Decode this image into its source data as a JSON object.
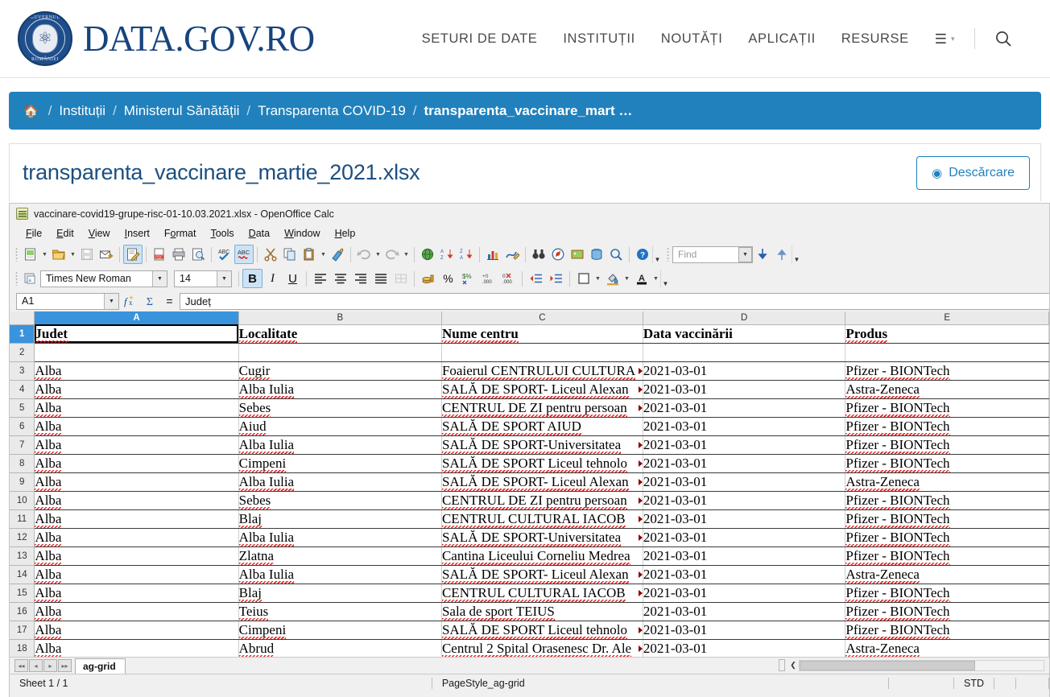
{
  "site": {
    "brand_name": "DATA.GOV.RO",
    "seal_top_text": "GUVERNUL",
    "seal_bottom_text": "ROMÂNIEI",
    "nav": [
      {
        "label": "SETURI DE DATE",
        "name": "nav-seturi-de-date"
      },
      {
        "label": "INSTITUȚII",
        "name": "nav-institutii"
      },
      {
        "label": "NOUTĂȚI",
        "name": "nav-noutati"
      },
      {
        "label": "APLICAȚII",
        "name": "nav-aplicatii"
      },
      {
        "label": "RESURSE",
        "name": "nav-resurse"
      }
    ],
    "menu_icon": "hamburger-icon",
    "menu_caret": "▾",
    "search_icon": "search-icon",
    "accent_color": "#2081bd",
    "brand_color": "#16447e"
  },
  "breadcrumb": {
    "home_icon": "home-icon",
    "separator": "/",
    "items": [
      "Instituții",
      "Ministerul Sănătății",
      "Transparenta COVID-19"
    ],
    "current": "transparenta_vaccinare_mart …"
  },
  "resource": {
    "title": "transparenta_vaccinare_martie_2021.xlsx",
    "download_label": "Descărcare",
    "download_icon": "download-circle-icon"
  },
  "office": {
    "window_title": "vaccinare-covid19-grupe-risc-01-10.03.2021.xlsx - OpenOffice Calc",
    "app_icon": "calc-document-icon",
    "menus": [
      "File",
      "Edit",
      "View",
      "Insert",
      "Format",
      "Tools",
      "Data",
      "Window",
      "Help"
    ],
    "toolbar_icons": [
      "new-document-icon",
      "open-folder-icon",
      "save-icon",
      "email-document-icon",
      "edit-file-icon",
      "export-pdf-icon",
      "print-icon",
      "print-preview-icon",
      "spelling-check-icon",
      "autospellcheck-icon",
      "cut-scissors-icon",
      "copy-icon",
      "paste-icon",
      "clone-formatting-brush-icon",
      "undo-icon",
      "redo-icon",
      "hyperlink-globe-icon",
      "sort-ascending-icon",
      "sort-descending-icon",
      "insert-chart-icon",
      "draw-functions-icon",
      "find-replace-binoculars-icon",
      "navigator-compass-icon",
      "gallery-image-icon",
      "data-sources-icon",
      "zoom-magnifier-icon",
      "help-icon"
    ],
    "find": {
      "placeholder": "Find",
      "find_next_icon": "find-next-arrow-icon",
      "find_previous_icon": "find-previous-arrow-icon"
    },
    "format": {
      "style_icon": "apply-style-icon",
      "font_name": "Times New Roman",
      "font_size": "14",
      "bold_label": "B",
      "italic_label": "I",
      "underline_label": "U",
      "bold_active": true,
      "align_icons": [
        "align-left-icon",
        "align-center-icon",
        "align-right-icon",
        "align-justified-icon",
        "merge-cells-icon"
      ],
      "number_icons": [
        "currency-format-icon",
        "percent-format-icon",
        "number-format-icon",
        "add-decimal-icon",
        "delete-decimal-icon",
        "decrease-indent-icon",
        "increase-indent-icon",
        "borders-icon",
        "background-color-icon",
        "font-color-icon"
      ]
    },
    "formula_bar": {
      "name_box": "A1",
      "function_wizard_icon": "fx-icon",
      "sum_icon": "sigma-icon",
      "equals_icon": "=",
      "content": "Județ"
    },
    "sheet_tabs": {
      "first_icon": "first-sheet-icon",
      "prev_icon": "previous-sheet-icon",
      "next_icon": "next-sheet-icon",
      "last_icon": "last-sheet-icon",
      "active_tab": "ag-grid"
    },
    "status": {
      "sheet_count": "Sheet 1 / 1",
      "page_style": "PageStyle_ag-grid",
      "selection_mode": "STD"
    }
  },
  "spreadsheet": {
    "columns": [
      "A",
      "B",
      "C",
      "D",
      "E"
    ],
    "selected_column": "A",
    "selected_row": 1,
    "selected_cell": "A1",
    "rows": [
      {
        "n": 1,
        "cells": [
          "Judet",
          "Localitate",
          "Nume centru",
          "Data vaccinării",
          "Produs"
        ],
        "header": true
      },
      {
        "n": 2,
        "cells": [
          "",
          "",
          "",
          "",
          ""
        ]
      },
      {
        "n": 3,
        "cells": [
          "Alba",
          "Cugir",
          "Foaierul CENTRULUI CULTURA",
          "2021-03-01",
          "Pfizer - BIONTech"
        ],
        "overflow_c": true
      },
      {
        "n": 4,
        "cells": [
          "Alba",
          "Alba Iulia",
          "SALĂ DE SPORT- Liceul Alexan",
          "2021-03-01",
          "Astra-Zeneca"
        ],
        "overflow_c": true
      },
      {
        "n": 5,
        "cells": [
          "Alba",
          "Sebes",
          "CENTRUL DE ZI pentru persoan",
          "2021-03-01",
          "Pfizer - BIONTech"
        ],
        "overflow_c": true
      },
      {
        "n": 6,
        "cells": [
          "Alba",
          "Aiud",
          "SALĂ DE SPORT AIUD",
          "2021-03-01",
          "Pfizer - BIONTech"
        ],
        "overflow_c": false
      },
      {
        "n": 7,
        "cells": [
          "Alba",
          "Alba Iulia",
          "SALĂ DE SPORT-Universitatea",
          "2021-03-01",
          "Pfizer - BIONTech"
        ],
        "overflow_c": true
      },
      {
        "n": 8,
        "cells": [
          "Alba",
          "Cimpeni",
          "SALĂ DE SPORT Liceul tehnolo",
          "2021-03-01",
          "Pfizer - BIONTech"
        ],
        "overflow_c": true
      },
      {
        "n": 9,
        "cells": [
          "Alba",
          "Alba Iulia",
          "SALĂ DE SPORT- Liceul Alexan",
          "2021-03-01",
          "Astra-Zeneca"
        ],
        "overflow_c": true
      },
      {
        "n": 10,
        "cells": [
          "Alba",
          "Sebes",
          "CENTRUL DE ZI pentru persoan",
          "2021-03-01",
          "Pfizer - BIONTech"
        ],
        "overflow_c": true
      },
      {
        "n": 11,
        "cells": [
          "Alba",
          "Blaj",
          "CENTRUL CULTURAL IACOB",
          "2021-03-01",
          "Pfizer - BIONTech"
        ],
        "overflow_c": true
      },
      {
        "n": 12,
        "cells": [
          "Alba",
          "Alba Iulia",
          "SALĂ DE SPORT-Universitatea",
          "2021-03-01",
          "Pfizer - BIONTech"
        ],
        "overflow_c": true
      },
      {
        "n": 13,
        "cells": [
          "Alba",
          "Zlatna",
          "Cantina Liceului Corneliu Medrea",
          "2021-03-01",
          "Pfizer - BIONTech"
        ],
        "overflow_c": false
      },
      {
        "n": 14,
        "cells": [
          "Alba",
          "Alba Iulia",
          "SALĂ DE SPORT- Liceul Alexan",
          "2021-03-01",
          "Astra-Zeneca"
        ],
        "overflow_c": true
      },
      {
        "n": 15,
        "cells": [
          "Alba",
          "Blaj",
          "CENTRUL CULTURAL IACOB",
          "2021-03-01",
          "Pfizer - BIONTech"
        ],
        "overflow_c": true
      },
      {
        "n": 16,
        "cells": [
          "Alba",
          "Teius",
          "Sala de sport TEIUS",
          "2021-03-01",
          "Pfizer - BIONTech"
        ],
        "overflow_c": false
      },
      {
        "n": 17,
        "cells": [
          "Alba",
          "Cimpeni",
          "SALĂ DE SPORT Liceul tehnolo",
          "2021-03-01",
          "Pfizer - BIONTech"
        ],
        "overflow_c": true
      },
      {
        "n": 18,
        "cells": [
          "Alba",
          "Abrud",
          "Centrul 2 Spital Orasenesc Dr. Ale",
          "2021-03-01",
          "Astra-Zeneca"
        ],
        "overflow_c": true
      }
    ]
  }
}
